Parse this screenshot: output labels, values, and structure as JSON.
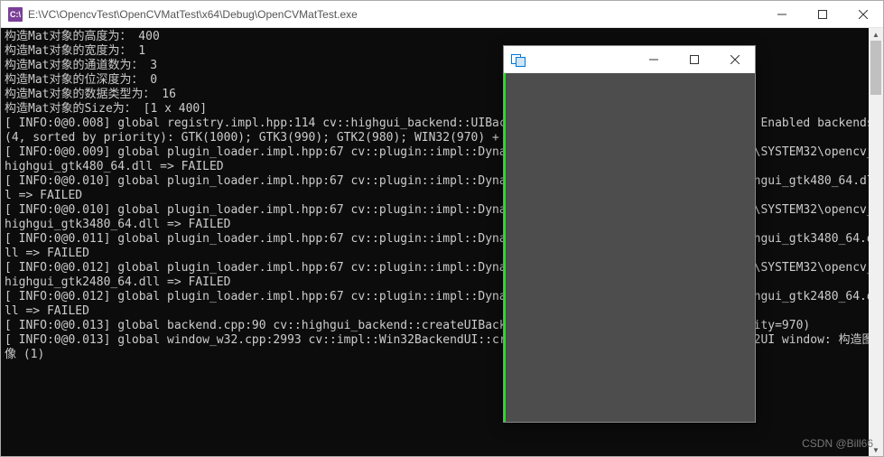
{
  "main_window": {
    "icon_text": "C:\\",
    "title": "E:\\VC\\OpencvTest\\OpenCVMatTest\\x64\\Debug\\OpenCVMatTest.exe"
  },
  "console_lines": [
    "构造Mat对象的高度为： 400",
    "构造Mat对象的宽度为： 1",
    "构造Mat对象的通道数为： 3",
    "构造Mat对象的位深度为： 0",
    "构造Mat对象的数据类型为： 16",
    "构造Mat对象的Size为： [1 x 400]",
    "[ INFO:0@0.008] global registry.impl.hpp:114 cv::highgui_backend::UIBackendRegistry::UIBackendRegistry UI: Enabled backends(4, sorted by priority): GTK(1000); GTK3(990); GTK2(980); WIN32(970) + BUILTIN(WIN32UI)",
    "[ INFO:0@0.009] global plugin_loader.impl.hpp:67 cv::plugin::impl::DynamicLib::libraryLoad load C:\\Windows\\SYSTEM32\\opencv_highgui_gtk480_64.dll => FAILED",
    "[ INFO:0@0.010] global plugin_loader.impl.hpp:67 cv::plugin::impl::DynamicLib::libraryLoad load opencv_highgui_gtk480_64.dll => FAILED",
    "[ INFO:0@0.010] global plugin_loader.impl.hpp:67 cv::plugin::impl::DynamicLib::libraryLoad load C:\\Windows\\SYSTEM32\\opencv_highgui_gtk3480_64.dll => FAILED",
    "[ INFO:0@0.011] global plugin_loader.impl.hpp:67 cv::plugin::impl::DynamicLib::libraryLoad load opencv_highgui_gtk3480_64.dll => FAILED",
    "[ INFO:0@0.012] global plugin_loader.impl.hpp:67 cv::plugin::impl::DynamicLib::libraryLoad load C:\\Windows\\SYSTEM32\\opencv_highgui_gtk2480_64.dll => FAILED",
    "[ INFO:0@0.012] global plugin_loader.impl.hpp:67 cv::plugin::impl::DynamicLib::libraryLoad load opencv_highgui_gtk2480_64.dll => FAILED",
    "[ INFO:0@0.013] global backend.cpp:90 cv::highgui_backend::createUIBackend UI: using backend: WIN32 (priority=970)",
    "[ INFO:0@0.013] global window_w32.cpp:2993 cv::impl::Win32BackendUI::createWindow OpenCV/UI: Creating Win32UI window: 构造图像 (1)"
  ],
  "watermark": "CSDN @Bill66"
}
